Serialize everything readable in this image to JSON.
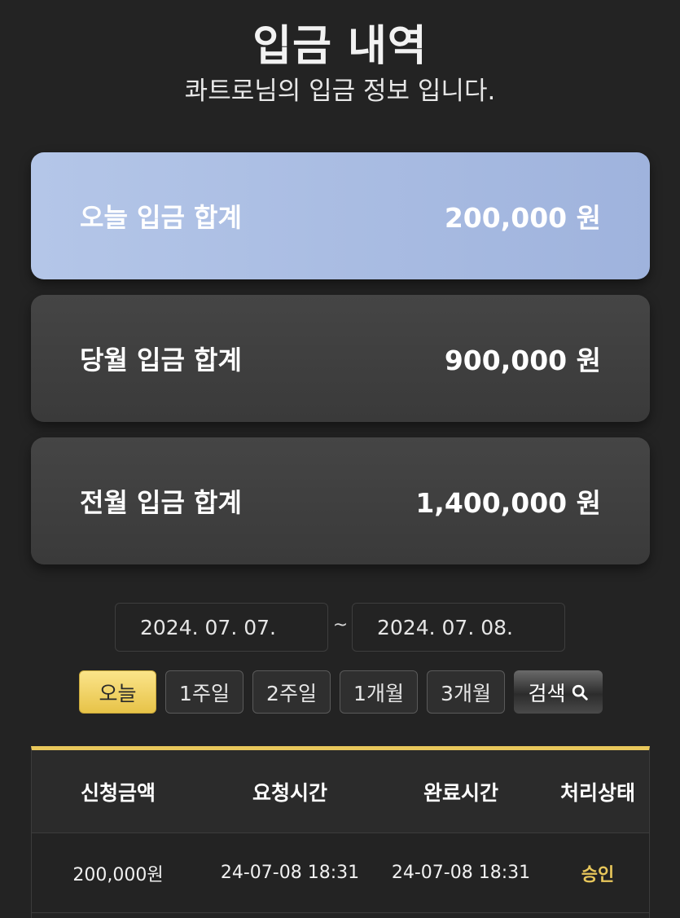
{
  "header": {
    "title": "입금 내역",
    "subtitle": "콰트로님의 입금 정보 입니다."
  },
  "summary": {
    "today": {
      "label": "오늘 입금 합계",
      "value": "200,000 원"
    },
    "month": {
      "label": "당월 입금 합계",
      "value": "900,000 원"
    },
    "previous_month": {
      "label": "전월 입금 합계",
      "value": "1,400,000 원"
    }
  },
  "date_filter": {
    "start": "2024. 07. 07.",
    "separator": "~",
    "end": "2024. 07. 08."
  },
  "period_buttons": [
    "오늘",
    "1주일",
    "2주일",
    "1개월",
    "3개월"
  ],
  "active_period_index": 0,
  "search_button": {
    "label": "검색",
    "icon": "search-icon"
  },
  "table": {
    "headers": [
      "신청금액",
      "요청시간",
      "완료시간",
      "처리상태"
    ],
    "rows": [
      [
        "200,000원",
        "24-07-08 18:31",
        "24-07-08 18:31",
        "승인"
      ]
    ]
  },
  "colors": {
    "background": "#232323",
    "today_card": "#b4c6e8",
    "accent_gold": "#e8c75b",
    "status_approved": "#e8c75b"
  }
}
